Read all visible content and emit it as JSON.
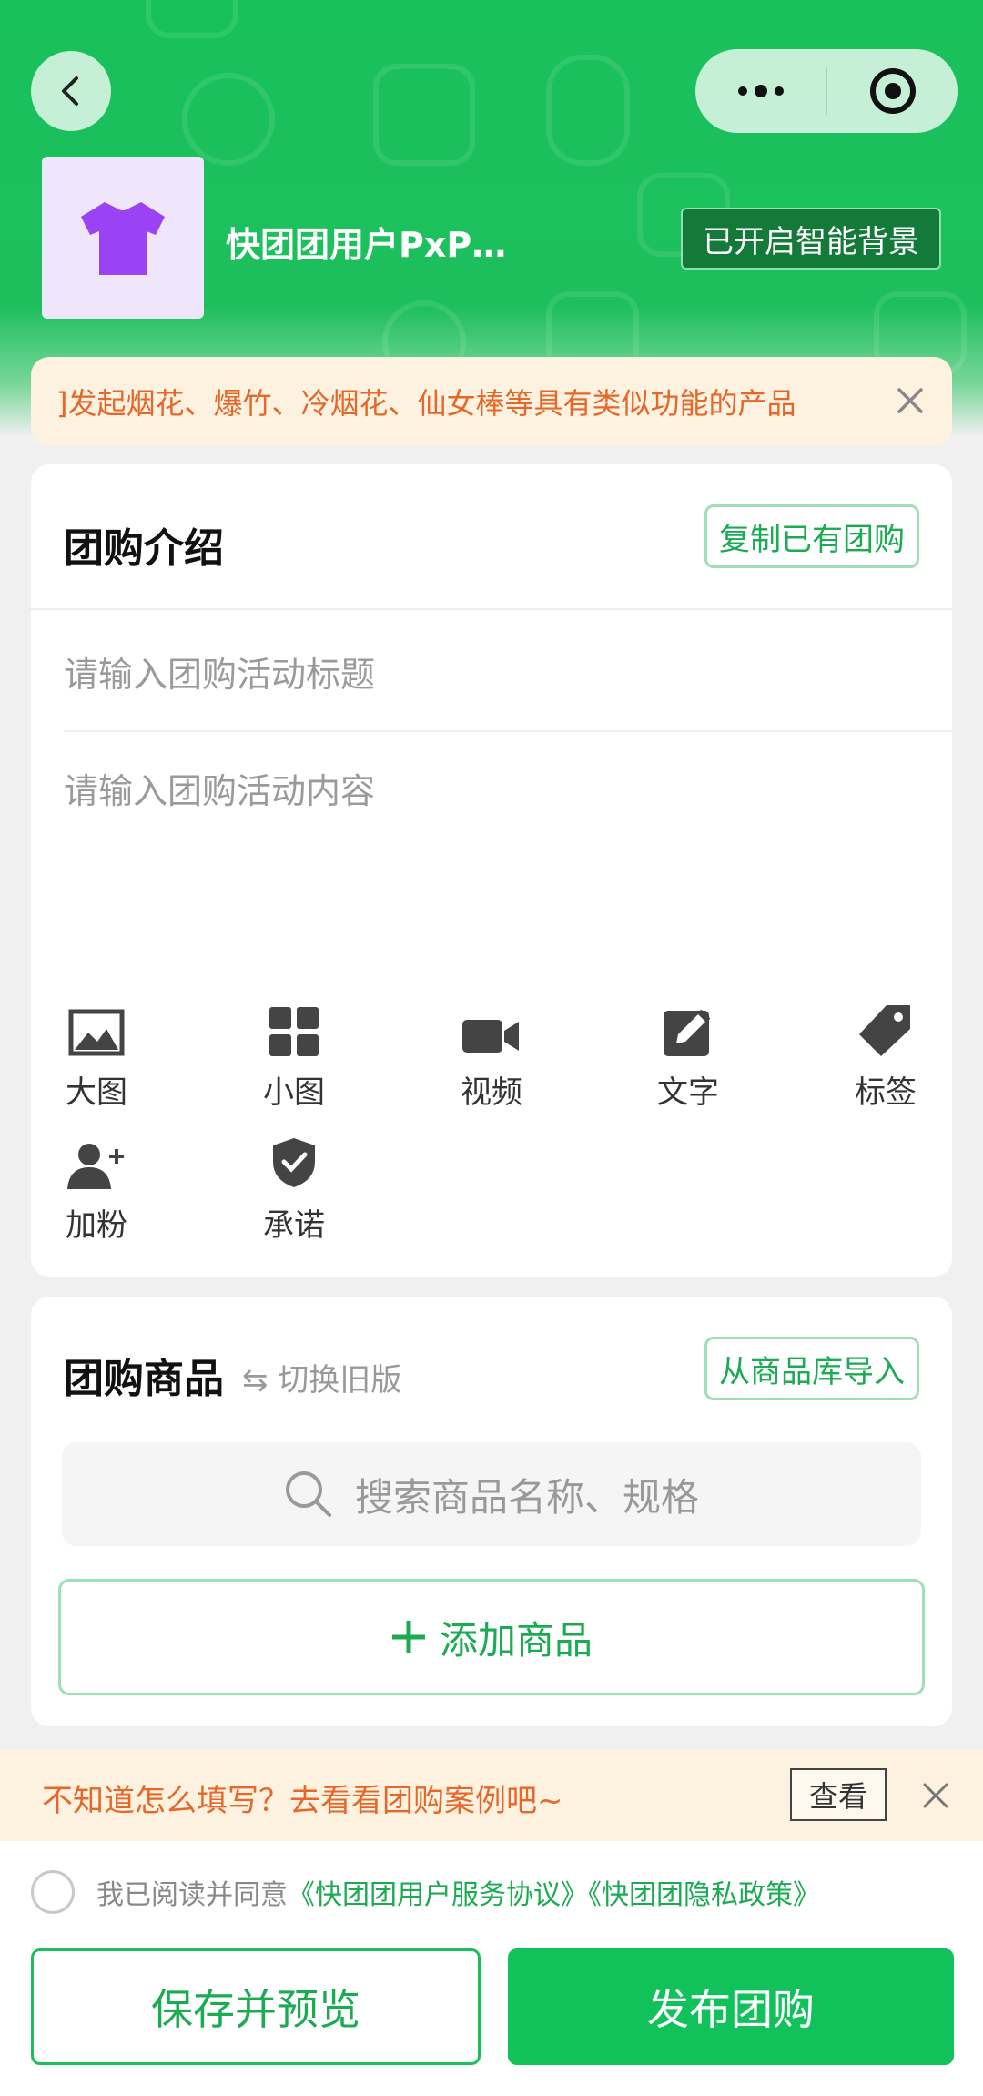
{
  "header": {
    "user_name": "快团团用户PxP…",
    "smart_bg_label": "已开启智能背景"
  },
  "notice": {
    "text": "]发起烟花、爆竹、冷烟花、仙女棒等具有类似功能的产品"
  },
  "intro": {
    "title": "团购介绍",
    "copy_button": "复制已有团购",
    "title_placeholder": "请输入团购活动标题",
    "content_placeholder": "请输入团购活动内容",
    "tools": [
      {
        "label": "大图",
        "icon": "large-image-icon"
      },
      {
        "label": "小图",
        "icon": "grid-icon"
      },
      {
        "label": "视频",
        "icon": "video-icon"
      },
      {
        "label": "文字",
        "icon": "edit-icon"
      },
      {
        "label": "标签",
        "icon": "tag-icon"
      },
      {
        "label": "加粉",
        "icon": "add-follower-icon"
      },
      {
        "label": "承诺",
        "icon": "shield-check-icon"
      }
    ]
  },
  "goods": {
    "title": "团购商品",
    "switch_label": "⇆ 切换旧版",
    "import_button": "从商品库导入",
    "search_placeholder": "搜索商品名称、规格",
    "add_label": "添加商品"
  },
  "tip": {
    "text": "不知道怎么填写？去看看团购案例吧~",
    "view_label": "查看"
  },
  "footer": {
    "agree_text": "我已阅读并同意",
    "agree_link": "《快团团用户服务协议》《快团团隐私政策》",
    "save_label": "保存并预览",
    "publish_label": "发布团购"
  },
  "colors": {
    "primary": "#1dbf5c",
    "accent_orange": "#e5672a",
    "badge_dark": "#147a3a"
  }
}
